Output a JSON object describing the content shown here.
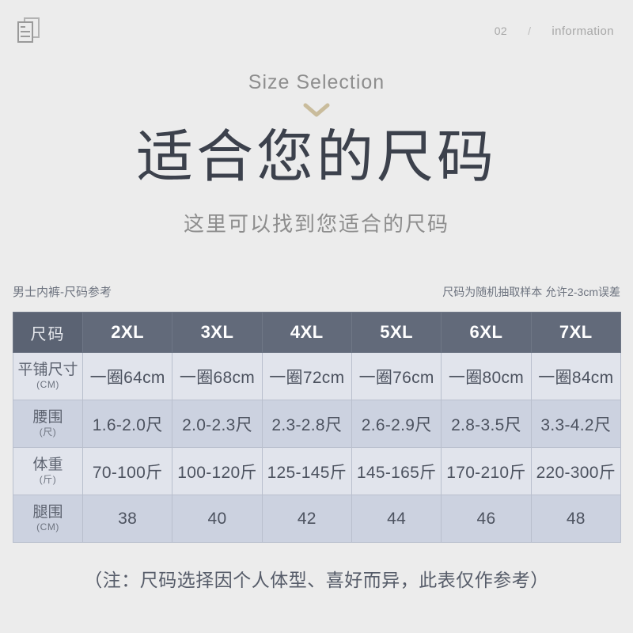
{
  "topbar": {
    "icon": "documents-icon",
    "number": "02",
    "separator": "/",
    "label": "information"
  },
  "hero": {
    "eyebrow": "Size Selection",
    "chevron_icon": "chevron-down-icon",
    "chevron_color": "#c9bc9c",
    "headline": "适合您的尺码",
    "subhead": "这里可以找到您适合的尺码"
  },
  "table_caption": {
    "left": "男士内裤-尺码参考",
    "right": "尺码为随机抽取样本 允许2-3cm误差"
  },
  "size_table": {
    "corner_label": "尺码",
    "columns": [
      "2XL",
      "3XL",
      "4XL",
      "5XL",
      "6XL",
      "7XL"
    ],
    "rows": [
      {
        "label": "平铺尺寸",
        "unit": "(CM)",
        "values": [
          "一圈64cm",
          "一圈68cm",
          "一圈72cm",
          "一圈76cm",
          "一圈80cm",
          "一圈84cm"
        ]
      },
      {
        "label": "腰围",
        "unit": "(尺)",
        "values": [
          "1.6-2.0尺",
          "2.0-2.3尺",
          "2.3-2.8尺",
          "2.6-2.9尺",
          "2.8-3.5尺",
          "3.3-4.2尺"
        ]
      },
      {
        "label": "体重",
        "unit": "(斤)",
        "values": [
          "70-100斤",
          "100-120斤",
          "125-145斤",
          "145-165斤",
          "170-210斤",
          "220-300斤"
        ]
      },
      {
        "label": "腿围",
        "unit": "(CM)",
        "values": [
          "38",
          "40",
          "42",
          "44",
          "46",
          "48"
        ]
      }
    ]
  },
  "footnote": "（注：尺码选择因个人体型、喜好而异，此表仅作参考）",
  "colors": {
    "page_background": "#ececec",
    "header_row": "#626a7a",
    "header_corner": "#5b6373",
    "row_light": "#e1e4ec",
    "row_dark": "#ccd2e0",
    "headline_text": "#3c414c",
    "muted_text": "#8d8d8d",
    "accent_chevron": "#c9bc9c"
  }
}
